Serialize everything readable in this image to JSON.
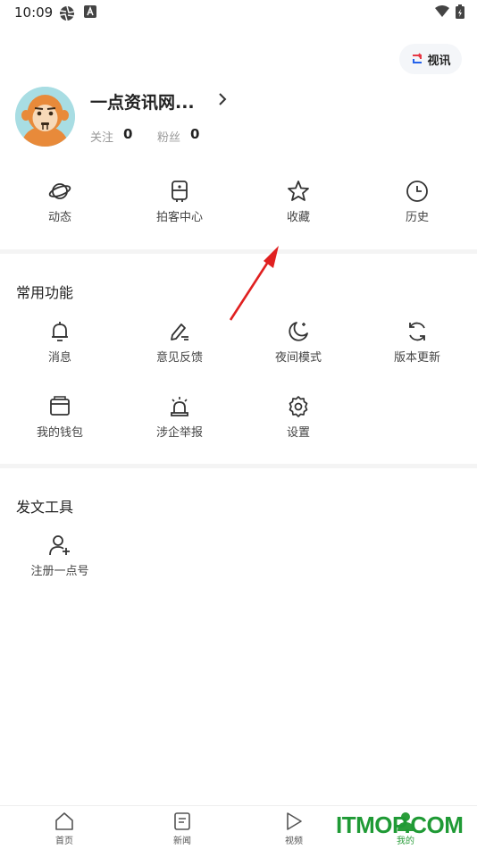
{
  "status": {
    "time": "10:09"
  },
  "video_button": {
    "label": "视讯"
  },
  "profile": {
    "name": "一点资讯网...",
    "follow_label": "关注",
    "follow_count": "0",
    "fans_label": "粉丝",
    "fans_count": "0"
  },
  "quick_actions": [
    {
      "label": "动态",
      "icon": "planet-icon"
    },
    {
      "label": "拍客中心",
      "icon": "camera-icon"
    },
    {
      "label": "收藏",
      "icon": "star-icon"
    },
    {
      "label": "历史",
      "icon": "clock-icon"
    }
  ],
  "common": {
    "title": "常用功能",
    "items": [
      {
        "label": "消息",
        "icon": "bell-icon"
      },
      {
        "label": "意见反馈",
        "icon": "pen-icon"
      },
      {
        "label": "夜间模式",
        "icon": "moon-icon"
      },
      {
        "label": "版本更新",
        "icon": "refresh-icon"
      },
      {
        "label": "我的钱包",
        "icon": "wallet-icon"
      },
      {
        "label": "涉企举报",
        "icon": "alarm-icon"
      },
      {
        "label": "设置",
        "icon": "gear-icon"
      }
    ]
  },
  "tools": {
    "title": "发文工具",
    "items": [
      {
        "label": "注册一点号",
        "icon": "add-user-icon"
      }
    ]
  },
  "bottom_nav": [
    {
      "label": "首页",
      "icon": "home-icon"
    },
    {
      "label": "新闻",
      "icon": "news-icon"
    },
    {
      "label": "视频",
      "icon": "play-icon"
    },
    {
      "label": "我的",
      "icon": "person-icon",
      "active": true
    }
  ],
  "watermark": "ITMOP.COM",
  "colors": {
    "accent": "#2a9d3a",
    "annotation_arrow": "#e02020"
  }
}
